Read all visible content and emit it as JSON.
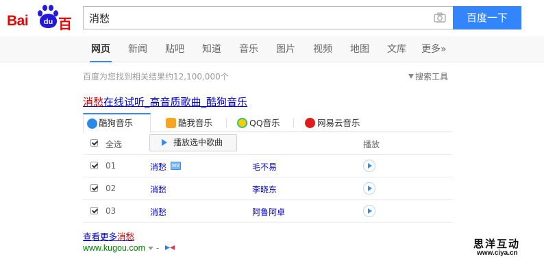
{
  "header": {
    "logo_text": "Bai",
    "logo_paw_text": "du",
    "logo_cn": "百度",
    "search_value": "消愁",
    "search_button": "百度一下"
  },
  "nav": {
    "tabs": [
      {
        "label": "网页",
        "active": true
      },
      {
        "label": "新闻"
      },
      {
        "label": "贴吧"
      },
      {
        "label": "知道"
      },
      {
        "label": "音乐"
      },
      {
        "label": "图片"
      },
      {
        "label": "视频"
      },
      {
        "label": "地图"
      },
      {
        "label": "文库"
      },
      {
        "label": "更多»"
      }
    ]
  },
  "results_info": {
    "count_text": "百度为您找到相关结果约12,100,000个",
    "tools_label": "搜索工具"
  },
  "result": {
    "title_highlight": "消愁",
    "title_rest": "在线试听_高音质歌曲_酷狗音乐",
    "panel_tabs": [
      {
        "label": "酷狗音乐",
        "active": true
      },
      {
        "label": "酷我音乐"
      },
      {
        "label": "QQ音乐"
      },
      {
        "label": "网易云音乐"
      }
    ],
    "header_row": {
      "select_all": "全选",
      "play_selected": "播放选中歌曲",
      "play_col": "播放"
    },
    "songs": [
      {
        "index": "01",
        "title": "消愁",
        "mv": "MV",
        "singer": "毛不易"
      },
      {
        "index": "02",
        "title": "消愁",
        "singer": "李晓东"
      },
      {
        "index": "03",
        "title": "消愁",
        "singer": "阿鲁阿卓"
      }
    ],
    "more_prefix": "查看更多",
    "more_highlight": "消愁",
    "url": "www.kugou.com",
    "url_dash": "-"
  },
  "watermark": {
    "text": "思洋互动",
    "url": "www.ciya.cn"
  },
  "colors": {
    "brand_red": "#e10601",
    "brand_blue": "#2319dc",
    "accent": "#3385ff",
    "link": "#0000cc",
    "highlight": "#cc0000",
    "url_green": "#008000"
  }
}
